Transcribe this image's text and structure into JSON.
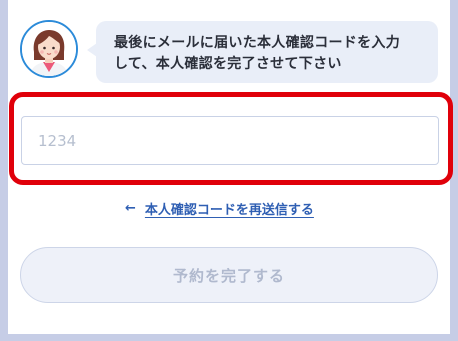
{
  "assistant": {
    "avatar_icon": "female-staff-avatar-icon",
    "message_line1": "最後にメールに届いた本人確認コードを入力",
    "message_line2": "して、本人確認を完了させて下さい"
  },
  "code_input": {
    "value": "",
    "placeholder": "1234"
  },
  "resend": {
    "icon": "arrow-left-icon",
    "arrow": "←",
    "label": "本人確認コードを再送信する"
  },
  "submit": {
    "label": "予約を完了する",
    "state": "disabled"
  },
  "colors": {
    "page_background": "#c6cde6",
    "highlight_border": "#e0000a",
    "link": "#2f5fb3",
    "avatar_ring": "#2c8bd9"
  }
}
